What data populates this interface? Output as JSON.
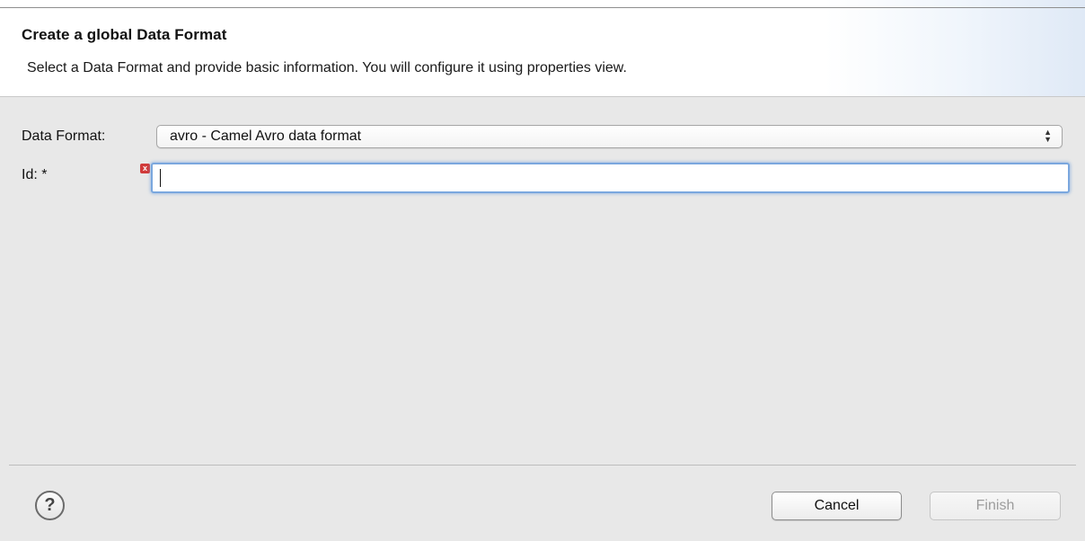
{
  "banner": {
    "title": "Create a global Data Format",
    "description": "Select a Data Format and provide basic information. You will configure it using properties view."
  },
  "form": {
    "data_format_label": "Data Format:",
    "data_format_value": "avro - Camel Avro data format",
    "id_label": "Id: *",
    "id_value": "",
    "id_error_glyph": "x"
  },
  "footer": {
    "help_glyph": "?",
    "cancel_label": "Cancel",
    "finish_label": "Finish"
  },
  "icons": {
    "select_arrows": "updown-chevron-icon",
    "error": "error-icon",
    "help": "help-icon"
  },
  "colors": {
    "focus_ring": "#7aa7de",
    "error": "#d13a3a",
    "disabled_text": "#9c9c9c"
  }
}
